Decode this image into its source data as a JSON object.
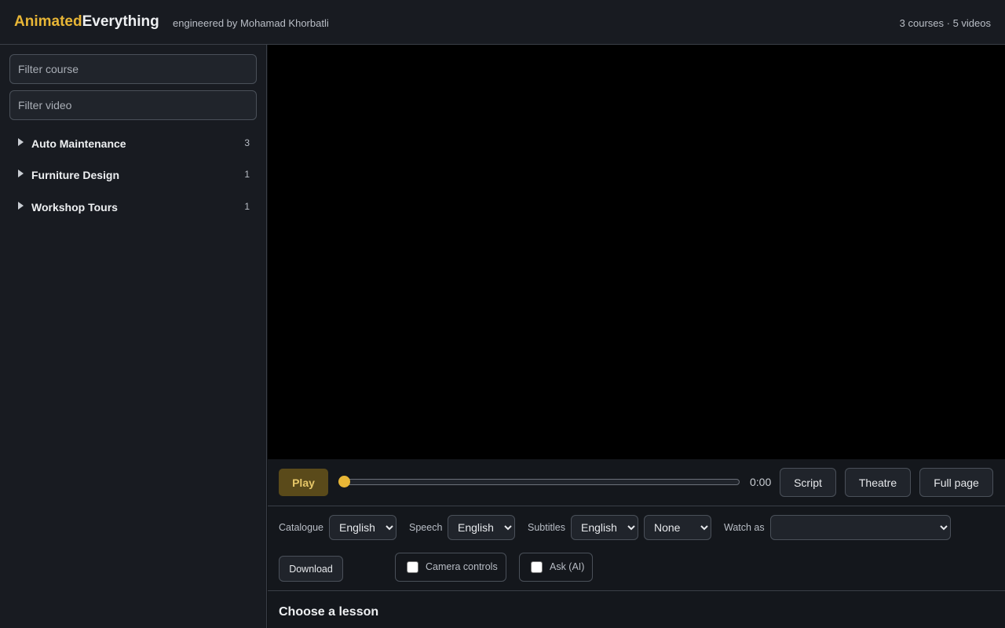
{
  "header": {
    "brand_a": "Animated",
    "brand_b": "Everything",
    "byline": "engineered by Mohamad Khorbatli",
    "stats": "3 courses · 5 videos"
  },
  "sidebar": {
    "filter_course_placeholder": "Filter course",
    "filter_video_placeholder": "Filter video",
    "courses": [
      {
        "name": "Auto Maintenance",
        "count": "3"
      },
      {
        "name": "Furniture Design",
        "count": "1"
      },
      {
        "name": "Workshop Tours",
        "count": "1"
      }
    ]
  },
  "player": {
    "play_label": "Play",
    "progress": 0,
    "time": "0:00",
    "script_label": "Script",
    "theatre_label": "Theatre",
    "fullpage_label": "Full page"
  },
  "options": {
    "catalogue_label": "Catalogue",
    "catalogue_value": "English",
    "speech_label": "Speech",
    "speech_value": "English",
    "subtitles_label": "Subtitles",
    "subtitles_value": "English",
    "subtitles_style_value": "None",
    "watchas_label": "Watch as",
    "watchas_value": "",
    "download_label": "Download",
    "camera_label": "Camera controls",
    "ask_label": "Ask (AI)"
  },
  "lesson_heading": "Choose a lesson",
  "colors": {
    "accent": "#e8b636",
    "background": "#0f1115",
    "panel": "#181b21"
  }
}
